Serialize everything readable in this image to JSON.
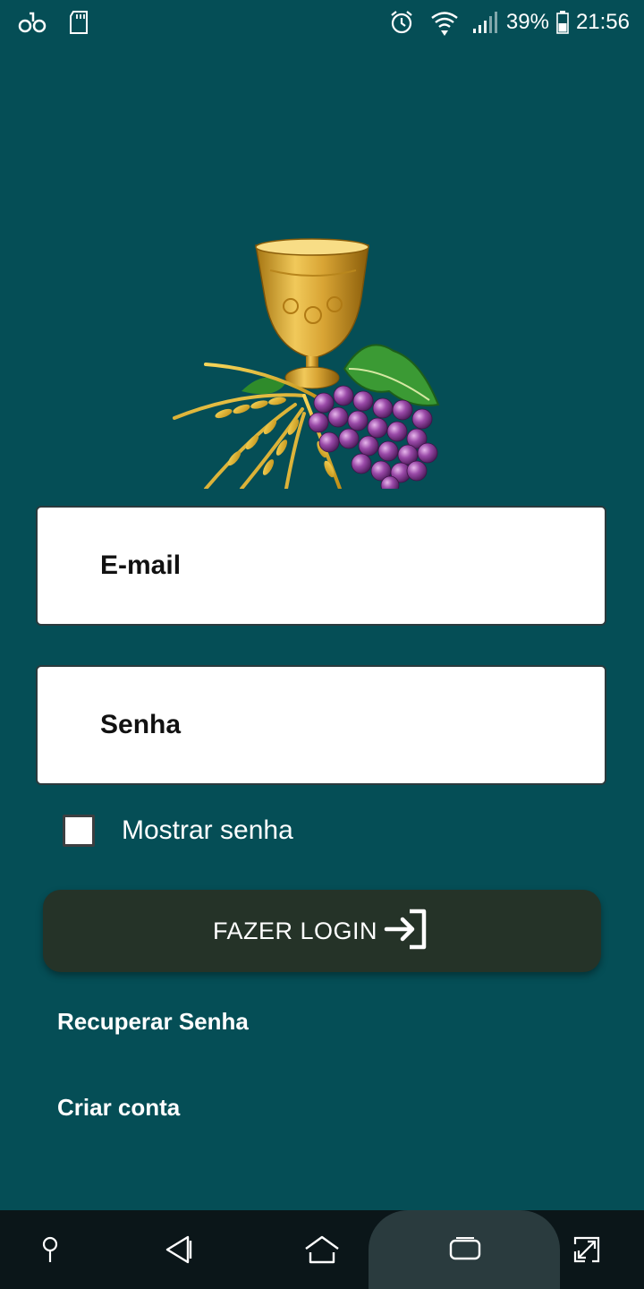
{
  "status_bar": {
    "battery_percent": "39%",
    "time": "21:56",
    "icons": [
      "carrier-oo-icon",
      "sd-card-icon",
      "alarm-icon",
      "wifi-icon",
      "signal-icon",
      "battery-icon"
    ]
  },
  "login_form": {
    "email_placeholder": "E-mail",
    "password_placeholder": "Senha",
    "show_password_label": "Mostrar senha",
    "show_password_checked": false,
    "login_button_label": "FAZER LOGIN",
    "recover_password_link": "Recuperar Senha",
    "create_account_link": "Criar conta"
  },
  "nav_bar": {
    "icons": [
      "pin-icon",
      "back-icon",
      "home-icon",
      "recent-apps-icon",
      "screen-rotate-icon"
    ]
  },
  "colors": {
    "background": "#054e56",
    "button": "#253328",
    "nav_bar": "#0b1619",
    "field": "#ffffff",
    "text_light": "#ffffff"
  }
}
